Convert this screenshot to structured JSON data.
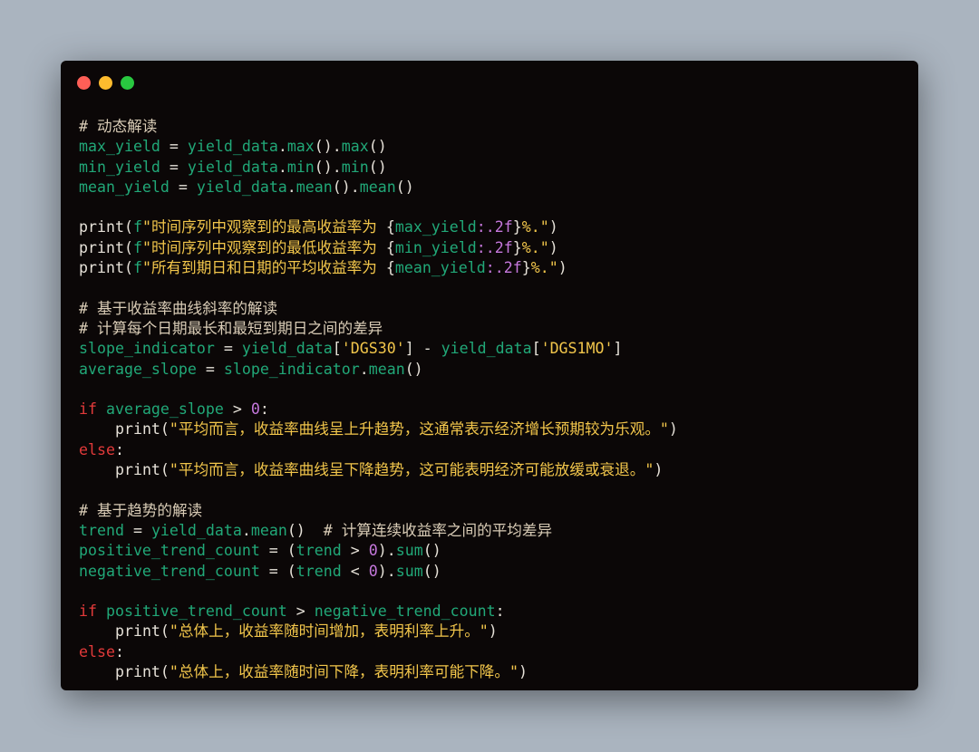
{
  "window": {
    "buttons": [
      "close",
      "minimize",
      "zoom"
    ]
  },
  "colors": {
    "background": "#aab4bf",
    "editor": "#0b0707",
    "comment": "#d9ccb6",
    "identifier": "#21a878",
    "string": "#f2c64b",
    "number": "#c678dd",
    "keyword": "#e23a3a",
    "plain": "#e6e1d8"
  },
  "code": {
    "lines": [
      [
        [
          "comment",
          "# 动态解读"
        ]
      ],
      [
        [
          "var",
          "max_yield"
        ],
        [
          "op",
          " = "
        ],
        [
          "var",
          "yield_data"
        ],
        [
          "punc",
          "."
        ],
        [
          "fn",
          "max"
        ],
        [
          "punc",
          "()."
        ],
        [
          "fn",
          "max"
        ],
        [
          "punc",
          "()"
        ]
      ],
      [
        [
          "var",
          "min_yield"
        ],
        [
          "op",
          " = "
        ],
        [
          "var",
          "yield_data"
        ],
        [
          "punc",
          "."
        ],
        [
          "fn",
          "min"
        ],
        [
          "punc",
          "()."
        ],
        [
          "fn",
          "min"
        ],
        [
          "punc",
          "()"
        ]
      ],
      [
        [
          "var",
          "mean_yield"
        ],
        [
          "op",
          " = "
        ],
        [
          "var",
          "yield_data"
        ],
        [
          "punc",
          "."
        ],
        [
          "fn",
          "mean"
        ],
        [
          "punc",
          "()."
        ],
        [
          "fn",
          "mean"
        ],
        [
          "punc",
          "()"
        ]
      ],
      [],
      [
        [
          "builtin",
          "print"
        ],
        [
          "punc",
          "("
        ],
        [
          "var",
          "f"
        ],
        [
          "str",
          "\"时间序列中观察到的最高收益率为 "
        ],
        [
          "brace",
          "{"
        ],
        [
          "var",
          "max_yield"
        ],
        [
          "fmt",
          ":.2f"
        ],
        [
          "brace",
          "}"
        ],
        [
          "str",
          "%.\""
        ],
        [
          "punc",
          ")"
        ]
      ],
      [
        [
          "builtin",
          "print"
        ],
        [
          "punc",
          "("
        ],
        [
          "var",
          "f"
        ],
        [
          "str",
          "\"时间序列中观察到的最低收益率为 "
        ],
        [
          "brace",
          "{"
        ],
        [
          "var",
          "min_yield"
        ],
        [
          "fmt",
          ":.2f"
        ],
        [
          "brace",
          "}"
        ],
        [
          "str",
          "%.\""
        ],
        [
          "punc",
          ")"
        ]
      ],
      [
        [
          "builtin",
          "print"
        ],
        [
          "punc",
          "("
        ],
        [
          "var",
          "f"
        ],
        [
          "str",
          "\"所有到期日和日期的平均收益率为 "
        ],
        [
          "brace",
          "{"
        ],
        [
          "var",
          "mean_yield"
        ],
        [
          "fmt",
          ":.2f"
        ],
        [
          "brace",
          "}"
        ],
        [
          "str",
          "%.\""
        ],
        [
          "punc",
          ")"
        ]
      ],
      [],
      [
        [
          "comment",
          "# 基于收益率曲线斜率的解读"
        ]
      ],
      [
        [
          "comment",
          "# 计算每个日期最长和最短到期日之间的差异"
        ]
      ],
      [
        [
          "var",
          "slope_indicator"
        ],
        [
          "op",
          " = "
        ],
        [
          "var",
          "yield_data"
        ],
        [
          "punc",
          "["
        ],
        [
          "str",
          "'DGS30'"
        ],
        [
          "punc",
          "]"
        ],
        [
          "op",
          " - "
        ],
        [
          "var",
          "yield_data"
        ],
        [
          "punc",
          "["
        ],
        [
          "str",
          "'DGS1MO'"
        ],
        [
          "punc",
          "]"
        ]
      ],
      [
        [
          "var",
          "average_slope"
        ],
        [
          "op",
          " = "
        ],
        [
          "var",
          "slope_indicator"
        ],
        [
          "punc",
          "."
        ],
        [
          "fn",
          "mean"
        ],
        [
          "punc",
          "()"
        ]
      ],
      [],
      [
        [
          "kw",
          "if"
        ],
        [
          "text",
          " "
        ],
        [
          "var",
          "average_slope"
        ],
        [
          "op",
          " > "
        ],
        [
          "num",
          "0"
        ],
        [
          "punc",
          ":"
        ]
      ],
      [
        [
          "text",
          "    "
        ],
        [
          "builtin",
          "print"
        ],
        [
          "punc",
          "("
        ],
        [
          "str",
          "\"平均而言，收益率曲线呈上升趋势，这通常表示经济增长预期较为乐观。\""
        ],
        [
          "punc",
          ")"
        ]
      ],
      [
        [
          "kw",
          "else"
        ],
        [
          "punc",
          ":"
        ]
      ],
      [
        [
          "text",
          "    "
        ],
        [
          "builtin",
          "print"
        ],
        [
          "punc",
          "("
        ],
        [
          "str",
          "\"平均而言，收益率曲线呈下降趋势，这可能表明经济可能放缓或衰退。\""
        ],
        [
          "punc",
          ")"
        ]
      ],
      [],
      [
        [
          "comment",
          "# 基于趋势的解读"
        ]
      ],
      [
        [
          "var",
          "trend"
        ],
        [
          "op",
          " = "
        ],
        [
          "var",
          "yield_data"
        ],
        [
          "punc",
          "."
        ],
        [
          "fn",
          "mean"
        ],
        [
          "punc",
          "()"
        ],
        [
          "text",
          "  "
        ],
        [
          "comment",
          "# 计算连续收益率之间的平均差异"
        ]
      ],
      [
        [
          "var",
          "positive_trend_count"
        ],
        [
          "op",
          " = "
        ],
        [
          "punc",
          "("
        ],
        [
          "var",
          "trend"
        ],
        [
          "op",
          " > "
        ],
        [
          "num",
          "0"
        ],
        [
          "punc",
          ")."
        ],
        [
          "fn",
          "sum"
        ],
        [
          "punc",
          "()"
        ]
      ],
      [
        [
          "var",
          "negative_trend_count"
        ],
        [
          "op",
          " = "
        ],
        [
          "punc",
          "("
        ],
        [
          "var",
          "trend"
        ],
        [
          "op",
          " < "
        ],
        [
          "num",
          "0"
        ],
        [
          "punc",
          ")."
        ],
        [
          "fn",
          "sum"
        ],
        [
          "punc",
          "()"
        ]
      ],
      [],
      [
        [
          "kw",
          "if"
        ],
        [
          "text",
          " "
        ],
        [
          "var",
          "positive_trend_count"
        ],
        [
          "op",
          " > "
        ],
        [
          "var",
          "negative_trend_count"
        ],
        [
          "punc",
          ":"
        ]
      ],
      [
        [
          "text",
          "    "
        ],
        [
          "builtin",
          "print"
        ],
        [
          "punc",
          "("
        ],
        [
          "str",
          "\"总体上，收益率随时间增加，表明利率上升。\""
        ],
        [
          "punc",
          ")"
        ]
      ],
      [
        [
          "kw",
          "else"
        ],
        [
          "punc",
          ":"
        ]
      ],
      [
        [
          "text",
          "    "
        ],
        [
          "builtin",
          "print"
        ],
        [
          "punc",
          "("
        ],
        [
          "str",
          "\"总体上，收益率随时间下降，表明利率可能下降。\""
        ],
        [
          "punc",
          ")"
        ]
      ]
    ]
  }
}
